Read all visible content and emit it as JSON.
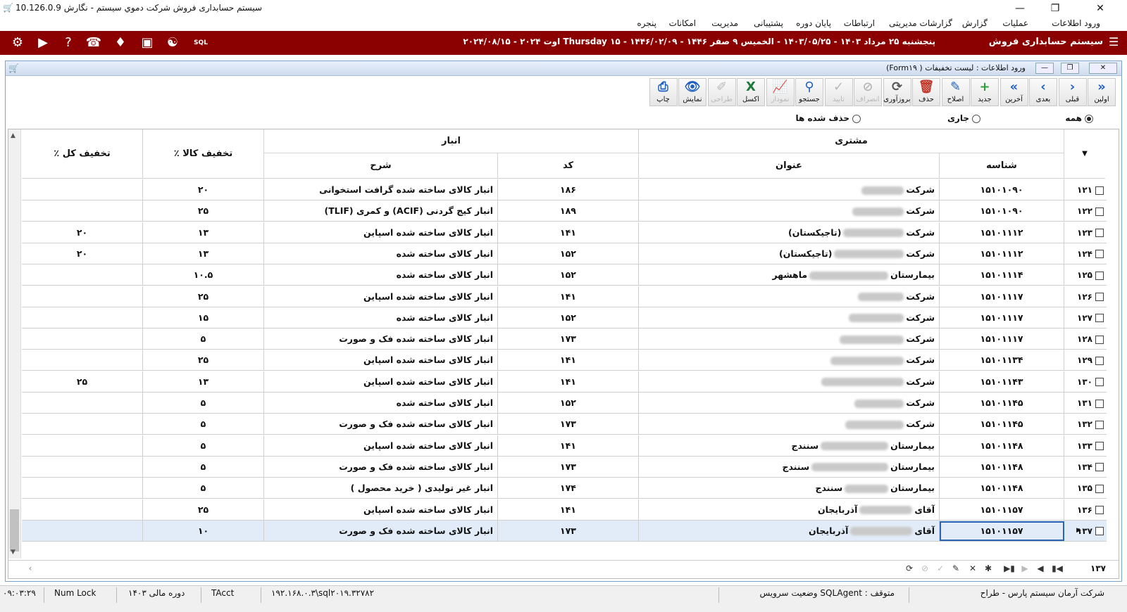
{
  "window": {
    "title": "سیستم حسابداری فروش شرکت دموي سیستم - نگارش 10.126.0.9"
  },
  "menu": [
    "ورود اطلاعات",
    "عملیات",
    "گزارش",
    "گزارشات مدیریتی",
    "ارتباطات",
    "پایان دوره",
    "پشتیبانی",
    "مدیریت",
    "امکانات",
    "پنجره"
  ],
  "banner": {
    "app_title": "سیستم حسابداری فروش",
    "date_text": "پنجشنبه ۲۵ مرداد ۱۴۰۳ - ۱۴۰۳/۰۵/۲۵ - الخمیس ۹ صفر ۱۴۴۶ - ۱۴۴۶/۰۲/۰۹ - ۱۵ Thursday اوت ۲۰۲۴ - ۲۰۲۴/۰۸/۱۵",
    "icons": [
      "settings-icon",
      "video-icon",
      "help-icon",
      "support-headset-icon",
      "bell-icon",
      "gift-icon",
      "handshake-icon",
      "sql-icon"
    ]
  },
  "form": {
    "title": "ورود اطلاعات : لیست تخفیفات ( Form۱۹)"
  },
  "toolbar": [
    {
      "key": "first",
      "label": "اولین",
      "icon": "»",
      "disabled": false
    },
    {
      "key": "prev",
      "label": "قبلی",
      "icon": "›",
      "disabled": false
    },
    {
      "key": "next",
      "label": "بعدی",
      "icon": "‹",
      "disabled": false
    },
    {
      "key": "last",
      "label": "آخرین",
      "icon": "«",
      "disabled": false
    },
    {
      "key": "new",
      "label": "جدید",
      "icon": "+",
      "disabled": false
    },
    {
      "key": "edit",
      "label": "اصلاح",
      "icon": "✎",
      "disabled": false
    },
    {
      "key": "delete",
      "label": "حذف",
      "icon": "🗑",
      "disabled": false
    },
    {
      "key": "refresh",
      "label": "بروزآوری",
      "icon": "⟳",
      "disabled": false
    },
    {
      "key": "cancel",
      "label": "انصراف",
      "icon": "⊘",
      "disabled": true
    },
    {
      "key": "confirm",
      "label": "تایید",
      "icon": "✓",
      "disabled": true
    },
    {
      "key": "search",
      "label": "جستجو",
      "icon": "⚲",
      "disabled": false
    },
    {
      "key": "chart",
      "label": "نمودار",
      "icon": "📈",
      "disabled": true
    },
    {
      "key": "excel",
      "label": "اکسل",
      "icon": "X",
      "disabled": false
    },
    {
      "key": "design",
      "label": "طراحی",
      "icon": "✐",
      "disabled": true
    },
    {
      "key": "show",
      "label": "نمایش",
      "icon": "👁",
      "disabled": false
    },
    {
      "key": "print",
      "label": "چاپ",
      "icon": "⎙",
      "disabled": false
    }
  ],
  "filters": {
    "all": "همه",
    "current": "جاری",
    "deleted": "حذف شده ها",
    "selected": "all"
  },
  "grid": {
    "group_headers": {
      "customer": "مشتری",
      "warehouse": "انبار"
    },
    "columns": {
      "id": "شناسه",
      "title": "عنوان",
      "code": "کد",
      "desc": "شرح",
      "item_discount": "٪ تخفیف کالا",
      "total_discount": "٪ تخفیف کل"
    },
    "rows": [
      {
        "n": "۱۲۱",
        "id": "۱۵۱۰۱۰۹۰",
        "t1": "شرکت",
        "t2": "",
        "code": "۱۸۶",
        "desc": "انبار کالای ساخته شده گرافت استخوانی",
        "item": "۲۰",
        "total": ""
      },
      {
        "n": "۱۲۲",
        "id": "۱۵۱۰۱۰۹۰",
        "t1": "شرکت",
        "t2": "",
        "code": "۱۸۹",
        "desc": "انبار کیج گردنی (ACIF) و کمری (TLIF)",
        "item": "۲۵",
        "total": ""
      },
      {
        "n": "۱۲۳",
        "id": "۱۵۱۰۱۱۱۲",
        "t1": "شرکت",
        "t2": "(تاجیکستان)",
        "code": "۱۴۱",
        "desc": "انبار کالای ساخته شده اسپاین",
        "item": "۱۳",
        "total": "۲۰"
      },
      {
        "n": "۱۲۴",
        "id": "۱۵۱۰۱۱۱۲",
        "t1": "شرکت",
        "t2": "(تاجیکستان)",
        "code": "۱۵۲",
        "desc": "انبار کالای ساخته شده",
        "item": "۱۳",
        "total": "۲۰"
      },
      {
        "n": "۱۲۵",
        "id": "۱۵۱۰۱۱۱۴",
        "t1": "بیمارستان",
        "t2": "ماهشهر",
        "code": "۱۵۲",
        "desc": "انبار کالای ساخته شده",
        "item": "۱۰.۵",
        "total": ""
      },
      {
        "n": "۱۲۶",
        "id": "۱۵۱۰۱۱۱۷",
        "t1": "شرکت",
        "t2": "",
        "code": "۱۴۱",
        "desc": "انبار کالای ساخته شده اسپاین",
        "item": "۲۵",
        "total": ""
      },
      {
        "n": "۱۲۷",
        "id": "۱۵۱۰۱۱۱۷",
        "t1": "شرکت",
        "t2": "",
        "code": "۱۵۲",
        "desc": "انبار کالای ساخته شده",
        "item": "۱۵",
        "total": ""
      },
      {
        "n": "۱۲۸",
        "id": "۱۵۱۰۱۱۱۷",
        "t1": "شرکت",
        "t2": "",
        "code": "۱۷۳",
        "desc": "انبار کالای ساخته شده فک و صورت",
        "item": "۵",
        "total": ""
      },
      {
        "n": "۱۲۹",
        "id": "۱۵۱۰۱۱۳۴",
        "t1": "شرکت",
        "t2": "",
        "code": "۱۴۱",
        "desc": "انبار کالای ساخته شده اسپاین",
        "item": "۲۵",
        "total": ""
      },
      {
        "n": "۱۳۰",
        "id": "۱۵۱۰۱۱۴۳",
        "t1": "شرکت",
        "t2": "",
        "code": "۱۴۱",
        "desc": "انبار کالای ساخته شده اسپاین",
        "item": "۱۳",
        "total": "۲۵"
      },
      {
        "n": "۱۳۱",
        "id": "۱۵۱۰۱۱۴۵",
        "t1": "شرکت",
        "t2": "",
        "code": "۱۵۲",
        "desc": "انبار کالای ساخته شده",
        "item": "۵",
        "total": ""
      },
      {
        "n": "۱۳۲",
        "id": "۱۵۱۰۱۱۴۵",
        "t1": "شرکت",
        "t2": "",
        "code": "۱۷۳",
        "desc": "انبار کالای ساخته شده فک و صورت",
        "item": "۵",
        "total": ""
      },
      {
        "n": "۱۳۳",
        "id": "۱۵۱۰۱۱۴۸",
        "t1": "بیمارستان",
        "t2": "سنندج",
        "code": "۱۴۱",
        "desc": "انبار کالای ساخته شده اسپاین",
        "item": "۵",
        "total": ""
      },
      {
        "n": "۱۳۴",
        "id": "۱۵۱۰۱۱۴۸",
        "t1": "بیمارستان",
        "t2": "سنندج",
        "code": "۱۷۳",
        "desc": "انبار کالای ساخته شده فک و صورت",
        "item": "۵",
        "total": ""
      },
      {
        "n": "۱۳۵",
        "id": "۱۵۱۰۱۱۴۸",
        "t1": "بیمارستان",
        "t2": "سنندج",
        "code": "۱۷۴",
        "desc": "انبار غیر تولیدی ( خرید محصول )",
        "item": "۵",
        "total": ""
      },
      {
        "n": "۱۳۶",
        "id": "۱۵۱۰۱۱۵۷",
        "t1": "آقای",
        "t2": "آذربایجان",
        "code": "۱۴۱",
        "desc": "انبار کالای ساخته شده اسپاین",
        "item": "۲۵",
        "total": ""
      },
      {
        "n": "۱۳۷",
        "id": "۱۵۱۰۱۱۵۷",
        "t1": "آقای",
        "t2": "آذربایجان",
        "code": "۱۷۳",
        "desc": "انبار کالای ساخته شده فک و صورت",
        "item": "۱۰",
        "total": ""
      }
    ],
    "record_count": "۱۳۷"
  },
  "statusbar": {
    "company": "شرکت آرمان سیستم پارس - طراح",
    "sqlagent": "متوقف : SQLAgent وضعیت سرویس",
    "server": "۱۹۲.۱۶۸.۰.۳\\sql۲۰۱۹.۳۲۷۸۲",
    "db": "TAcct",
    "fiscal": "دوره مالی ۱۴۰۳",
    "numlock": "Num Lock",
    "time": "۰۹:۰۳:۲۹"
  },
  "colors": {
    "banner": "#8b0000",
    "selection": "#2b63b5",
    "excel": "#1e7a3c",
    "green": "#2e9e3a",
    "blue": "#1f5fbf",
    "red": "#c0392b"
  }
}
